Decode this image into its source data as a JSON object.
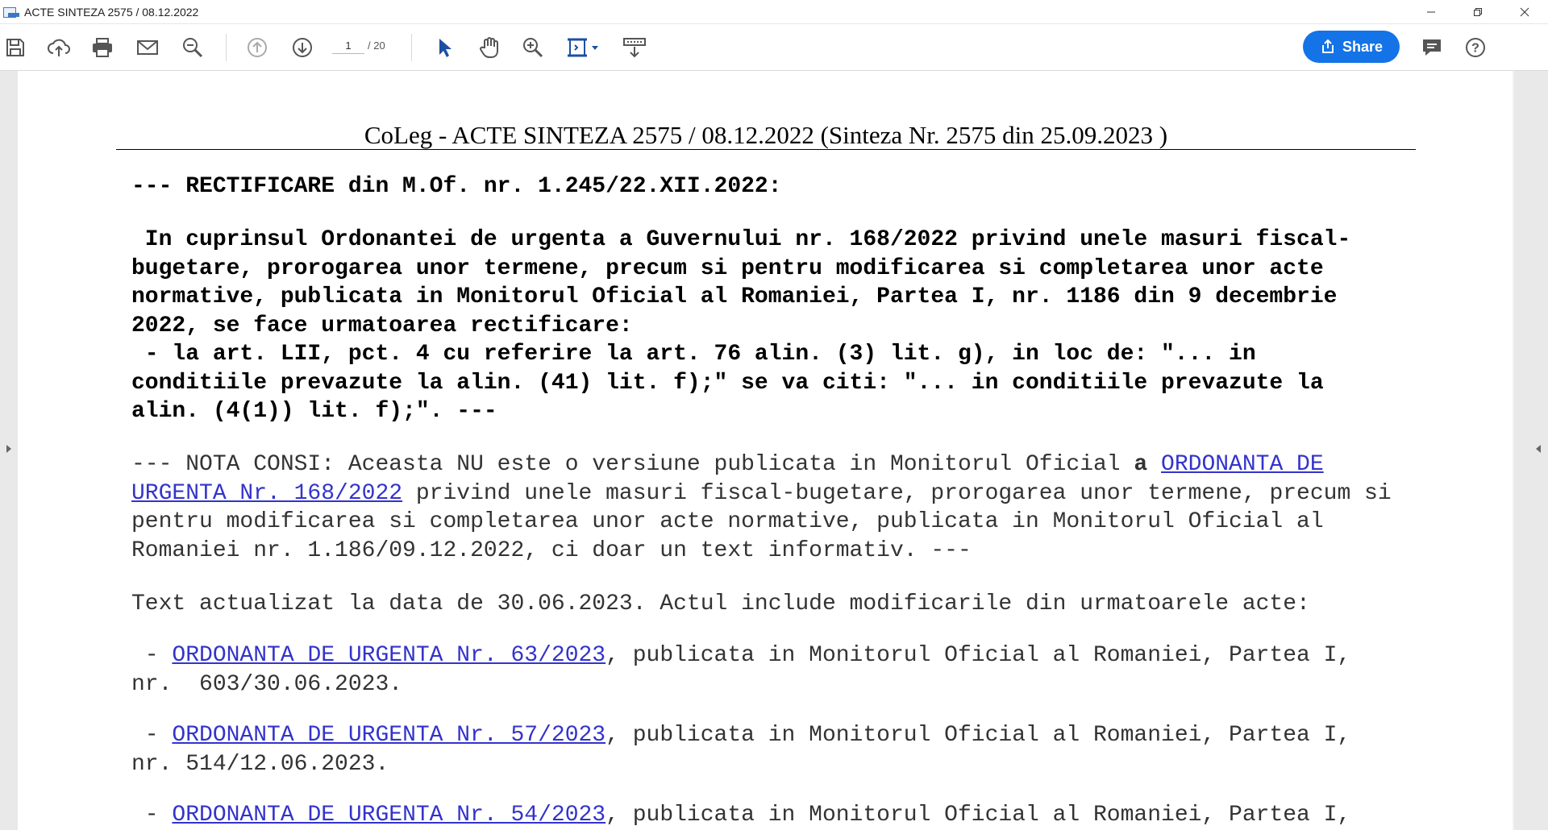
{
  "window": {
    "title": "ACTE SINTEZA 2575 / 08.12.2022",
    "controls": [
      "minimize-icon",
      "restore-icon",
      "close-icon"
    ]
  },
  "toolbar": {
    "page_current": "1",
    "page_total": "/ 20",
    "share_label": "Share",
    "accent_color": "#1473e6",
    "icons": [
      "save-icon",
      "upload-icon",
      "print-icon",
      "email-icon",
      "zoom-out-icon",
      "prev-page-icon",
      "next-page-icon",
      "select-cursor-icon",
      "hand-icon",
      "zoom-in-icon",
      "fit-page-icon",
      "read-mode-icon",
      "comment-icon",
      "help-icon"
    ]
  },
  "document": {
    "header": "CoLeg - ACTE SINTEZA 2575 / 08.12.2022 (Sinteza Nr. 2575 din 25.09.2023 )",
    "rectificare_title": "--- RECTIFICARE din M.Of. nr. 1.245/22.XII.2022:",
    "rectificare_lines": [
      " In cuprinsul Ordonantei de urgenta a Guvernului nr. 168/2022 privind unele masuri fiscal-",
      "bugetare, prorogarea unor termene, precum si pentru modificarea si completarea unor acte",
      "normative, publicata in Monitorul Oficial al Romaniei, Partea I, nr. 1186 din 9 decembrie",
      "2022, se face urmatoarea rectificare:",
      " - la art. LII, pct. 4 cu referire la art. 76 alin. (3) lit. g), in loc de: \"... in",
      "conditiile prevazute la alin. (41) lit. f);\" se va citi: \"... in conditiile prevazute la",
      "alin. (4(1)) lit. f);\". ---"
    ],
    "nota": {
      "prefix": "--- NOTA CONSI: Aceasta NU este o versiune publicata in Monitorul Oficial ",
      "a": "a",
      "space": " ",
      "link_part1": "ORDONANTA DE",
      "link_part2": "URGENTA Nr. 168/2022",
      "line2_rest": " privind unele masuri fiscal-bugetare, prorogarea unor termene, precum si",
      "line3": "pentru modificarea si completarea unor acte normative, publicata in Monitorul Oficial al",
      "line4": "Romaniei nr. 1.186/09.12.2022, ci doar un text informativ. ---"
    },
    "updated_text": "Text actualizat la data de 30.06.2023. Actul include modificarile din urmatoarele acte:",
    "acts": [
      {
        "dash": " - ",
        "link": "ORDONANTA DE URGENTA Nr. 63/2023",
        "rest": ", publicata in Monitorul Oficial al Romaniei, Partea I,",
        "line2": "nr.  603/30.06.2023."
      },
      {
        "dash": " - ",
        "link": "ORDONANTA DE URGENTA Nr. 57/2023",
        "rest": ", publicata in Monitorul Oficial al Romaniei, Partea I,",
        "line2": "nr. 514/12.06.2023."
      },
      {
        "dash": " - ",
        "link": "ORDONANTA DE URGENTA Nr. 54/2023",
        "rest": ", publicata in Monitorul Oficial al Romaniei, Partea I,",
        "line2": ""
      }
    ]
  }
}
